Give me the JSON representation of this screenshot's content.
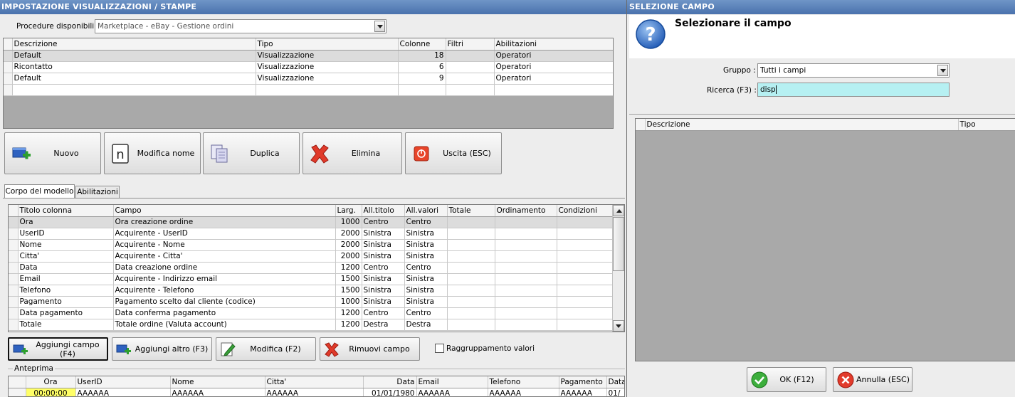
{
  "left": {
    "title": "IMPOSTAZIONE VISUALIZZAZIONI / STAMPE",
    "procedure_label": "Procedure disponibili :",
    "procedure_value": "Marketplace - eBay - Gestione ordini",
    "views": {
      "headers": [
        "Descrizione",
        "Tipo",
        "Colonne",
        "Filtri",
        "Abilitazioni"
      ],
      "rows": [
        [
          "Default",
          "Visualizzazione",
          "18",
          "",
          "Operatori"
        ],
        [
          "Ricontatto",
          "Visualizzazione",
          "6",
          "",
          "Operatori"
        ],
        [
          "Default",
          "Visualizzazione",
          "9",
          "",
          "Operatori"
        ]
      ]
    },
    "buttons": {
      "nuovo": "Nuovo",
      "modifica_nome": "Modifica nome",
      "duplica": "Duplica",
      "elimina": "Elimina",
      "uscita": "Uscita (ESC)"
    },
    "tabs": [
      "Corpo del modello",
      "Abilitazioni"
    ],
    "columns": {
      "headers": [
        "Titolo colonna",
        "Campo",
        "Larg.",
        "All.titolo",
        "All.valori",
        "Totale",
        "Ordinamento",
        "Condizioni"
      ],
      "rows": [
        [
          "Ora",
          "Ora creazione ordine",
          "1000",
          "Centro",
          "Centro",
          "",
          "",
          ""
        ],
        [
          "UserID",
          "Acquirente - UserID",
          "2000",
          "Sinistra",
          "Sinistra",
          "",
          "",
          ""
        ],
        [
          "Nome",
          "Acquirente - Nome",
          "2000",
          "Sinistra",
          "Sinistra",
          "",
          "",
          ""
        ],
        [
          "Citta'",
          "Acquirente - Citta'",
          "2000",
          "Sinistra",
          "Sinistra",
          "",
          "",
          ""
        ],
        [
          "Data",
          "Data creazione ordine",
          "1200",
          "Centro",
          "Centro",
          "",
          "",
          ""
        ],
        [
          "Email",
          "Acquirente - Indirizzo email",
          "1500",
          "Sinistra",
          "Sinistra",
          "",
          "",
          ""
        ],
        [
          "Telefono",
          "Acquirente - Telefono",
          "1500",
          "Sinistra",
          "Sinistra",
          "",
          "",
          ""
        ],
        [
          "Pagamento",
          "Pagamento scelto dal cliente (codice)",
          "1000",
          "Sinistra",
          "Sinistra",
          "",
          "",
          ""
        ],
        [
          "Data pagamento",
          "Data conferma pagamento",
          "1200",
          "Centro",
          "Centro",
          "",
          "",
          ""
        ],
        [
          "Totale",
          "Totale ordine (Valuta account)",
          "1200",
          "Destra",
          "Destra",
          "",
          "",
          ""
        ]
      ]
    },
    "field_buttons": {
      "aggiungi_campo": "Aggiungi campo (F4)",
      "aggiungi_altro": "Aggiungi altro (F3)",
      "modifica": "Modifica (F2)",
      "rimuovi": "Rimuovi campo"
    },
    "raggruppamento_label": "Raggruppamento valori",
    "preview": {
      "label": "Anteprima",
      "headers": [
        "Ora",
        "UserID",
        "Nome",
        "Citta'",
        "Data",
        "Email",
        "Telefono",
        "Pagamento",
        "Data"
      ],
      "row": [
        "00:00:00",
        "AAAAAA",
        "AAAAAA",
        "AAAAAA",
        "01/01/1980",
        "AAAAAA",
        "AAAAAA",
        "AAAAAA",
        "01/"
      ]
    }
  },
  "right": {
    "title": "SELEZIONE CAMPO",
    "heading": "Selezionare il campo",
    "gruppo_label": "Gruppo :",
    "gruppo_value": "Tutti i campi",
    "ricerca_label": "Ricerca (F3) :",
    "ricerca_value": "disp",
    "grid_headers": [
      "Descrizione",
      "Tipo"
    ],
    "ok_label": "OK (F12)",
    "annulla_label": "Annulla (ESC)"
  },
  "colors": {
    "title_bar": "#5a80b8",
    "search_bg": "#b6f0f2",
    "preview_highlight": "#ffff66"
  }
}
